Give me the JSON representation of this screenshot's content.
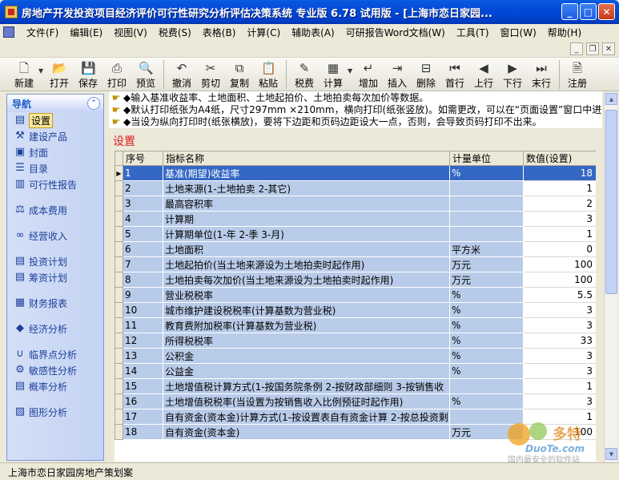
{
  "window": {
    "title": "房地产开发投资项目经济评价可行性研究分析评估决策系统 专业版 6.78 试用版 - [上海市恋日家园..."
  },
  "menu": [
    "文件(F)",
    "编辑(E)",
    "视图(V)",
    "税费(S)",
    "表格(B)",
    "计算(C)",
    "辅助表(A)",
    "可研报告Word文档(W)",
    "工具(T)",
    "窗口(W)",
    "帮助(H)"
  ],
  "toolbar": {
    "new": "新建",
    "open": "打开",
    "save": "保存",
    "print": "打印",
    "preview": "预览",
    "undo": "撤消",
    "cut": "剪切",
    "copy": "复制",
    "paste": "粘贴",
    "tax": "税费",
    "calc": "计算",
    "add": "增加",
    "insert": "插入",
    "delete": "删除",
    "first": "首行",
    "prev": "上行",
    "next": "下行",
    "last": "末行",
    "register": "注册"
  },
  "nav": {
    "header": "导航",
    "items": [
      "设置",
      "建设产品",
      "封面",
      "目录",
      "可行性报告",
      "成本费用",
      "经营收入",
      "投资计划",
      "筹资计划",
      "财务报表",
      "经济分析",
      "临界点分析",
      "敏感性分析",
      "概率分析",
      "图形分析"
    ]
  },
  "notes": [
    "◆输入基准收益率、土地面积、土地起拍价、土地拍卖每次加价等数据。",
    "◆默认打印纸张为A4纸，尺寸297mm ×210mm，横向打印(纸张竖放)。如需更改，可以在“页面设置”窗口中进",
    "◆当设为纵向打印时(纸张横放)，要将下边距和页码边距设大一点，否则，会导致页码打印不出来。"
  ],
  "section_title": "设置",
  "grid": {
    "headers": [
      "序号",
      "指标名称",
      "计量单位",
      "数值(设置)"
    ],
    "rows": [
      {
        "no": "1",
        "name": "基准(期望)收益率",
        "unit": "%",
        "value": "18"
      },
      {
        "no": "2",
        "name": "土地来源(1-土地拍卖 2-其它)",
        "unit": "",
        "value": "1"
      },
      {
        "no": "3",
        "name": "最高容积率",
        "unit": "",
        "value": "2"
      },
      {
        "no": "4",
        "name": "计算期",
        "unit": "",
        "value": "3"
      },
      {
        "no": "5",
        "name": "计算期单位(1-年 2-季 3-月)",
        "unit": "",
        "value": "1"
      },
      {
        "no": "6",
        "name": "土地面积",
        "unit": "平方米",
        "value": "0"
      },
      {
        "no": "7",
        "name": "土地起拍价(当土地来源设为土地拍卖时起作用)",
        "unit": "万元",
        "value": "100"
      },
      {
        "no": "8",
        "name": "土地拍卖每次加价(当土地来源设为土地拍卖时起作用)",
        "unit": "万元",
        "value": "100"
      },
      {
        "no": "9",
        "name": "营业税税率",
        "unit": "%",
        "value": "5.5"
      },
      {
        "no": "10",
        "name": "城市维护建设税税率(计算基数为营业税)",
        "unit": "%",
        "value": "3"
      },
      {
        "no": "11",
        "name": "教育费附加税率(计算基数为营业税)",
        "unit": "%",
        "value": "3"
      },
      {
        "no": "12",
        "name": "所得税税率",
        "unit": "%",
        "value": "33"
      },
      {
        "no": "13",
        "name": "公积金",
        "unit": "%",
        "value": "3"
      },
      {
        "no": "14",
        "name": "公益金",
        "unit": "%",
        "value": "3"
      },
      {
        "no": "15",
        "name": "土地增值税计算方式(1-按国务院条例 2-按财政部细则 3-按销售收",
        "unit": "",
        "value": "1"
      },
      {
        "no": "16",
        "name": "土地增值税税率(当设置为按销售收入比例预征时起作用)",
        "unit": "%",
        "value": "3"
      },
      {
        "no": "17",
        "name": "自有资金(资本金)计算方式(1-按设置表自有资金计算 2-按总投资剩",
        "unit": "",
        "value": "1"
      },
      {
        "no": "18",
        "name": "自有资金(资本金)",
        "unit": "万元",
        "value": "100"
      }
    ]
  },
  "status": {
    "text": "上海市恋日家园房地产策划案"
  },
  "watermark": {
    "brand": "DuoTe.com",
    "tagline": "国内最安全的软件站",
    "label": "多特"
  }
}
